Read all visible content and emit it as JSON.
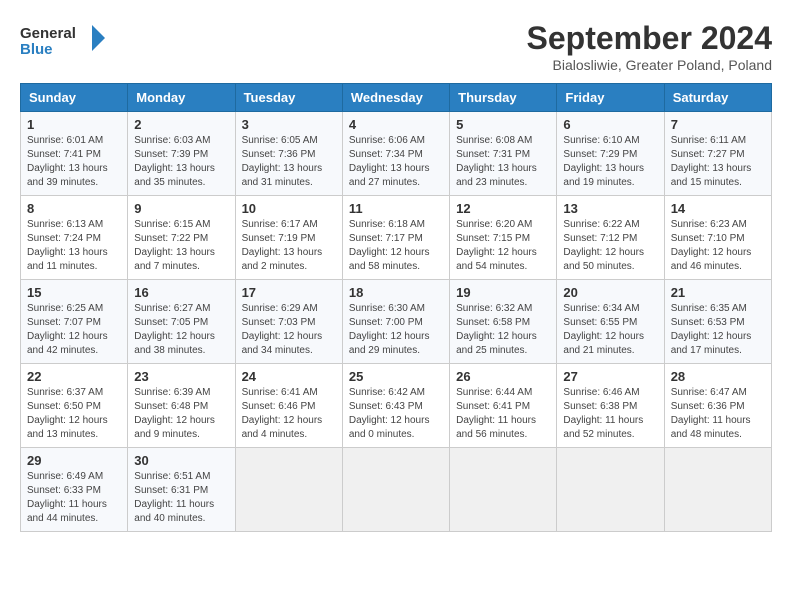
{
  "header": {
    "logo_general": "General",
    "logo_blue": "Blue",
    "title": "September 2024",
    "subtitle": "Bialosliwie, Greater Poland, Poland"
  },
  "calendar": {
    "days_of_week": [
      "Sunday",
      "Monday",
      "Tuesday",
      "Wednesday",
      "Thursday",
      "Friday",
      "Saturday"
    ],
    "weeks": [
      [
        {
          "day": "1",
          "info": "Sunrise: 6:01 AM\nSunset: 7:41 PM\nDaylight: 13 hours\nand 39 minutes."
        },
        {
          "day": "2",
          "info": "Sunrise: 6:03 AM\nSunset: 7:39 PM\nDaylight: 13 hours\nand 35 minutes."
        },
        {
          "day": "3",
          "info": "Sunrise: 6:05 AM\nSunset: 7:36 PM\nDaylight: 13 hours\nand 31 minutes."
        },
        {
          "day": "4",
          "info": "Sunrise: 6:06 AM\nSunset: 7:34 PM\nDaylight: 13 hours\nand 27 minutes."
        },
        {
          "day": "5",
          "info": "Sunrise: 6:08 AM\nSunset: 7:31 PM\nDaylight: 13 hours\nand 23 minutes."
        },
        {
          "day": "6",
          "info": "Sunrise: 6:10 AM\nSunset: 7:29 PM\nDaylight: 13 hours\nand 19 minutes."
        },
        {
          "day": "7",
          "info": "Sunrise: 6:11 AM\nSunset: 7:27 PM\nDaylight: 13 hours\nand 15 minutes."
        }
      ],
      [
        {
          "day": "8",
          "info": "Sunrise: 6:13 AM\nSunset: 7:24 PM\nDaylight: 13 hours\nand 11 minutes."
        },
        {
          "day": "9",
          "info": "Sunrise: 6:15 AM\nSunset: 7:22 PM\nDaylight: 13 hours\nand 7 minutes."
        },
        {
          "day": "10",
          "info": "Sunrise: 6:17 AM\nSunset: 7:19 PM\nDaylight: 13 hours\nand 2 minutes."
        },
        {
          "day": "11",
          "info": "Sunrise: 6:18 AM\nSunset: 7:17 PM\nDaylight: 12 hours\nand 58 minutes."
        },
        {
          "day": "12",
          "info": "Sunrise: 6:20 AM\nSunset: 7:15 PM\nDaylight: 12 hours\nand 54 minutes."
        },
        {
          "day": "13",
          "info": "Sunrise: 6:22 AM\nSunset: 7:12 PM\nDaylight: 12 hours\nand 50 minutes."
        },
        {
          "day": "14",
          "info": "Sunrise: 6:23 AM\nSunset: 7:10 PM\nDaylight: 12 hours\nand 46 minutes."
        }
      ],
      [
        {
          "day": "15",
          "info": "Sunrise: 6:25 AM\nSunset: 7:07 PM\nDaylight: 12 hours\nand 42 minutes."
        },
        {
          "day": "16",
          "info": "Sunrise: 6:27 AM\nSunset: 7:05 PM\nDaylight: 12 hours\nand 38 minutes."
        },
        {
          "day": "17",
          "info": "Sunrise: 6:29 AM\nSunset: 7:03 PM\nDaylight: 12 hours\nand 34 minutes."
        },
        {
          "day": "18",
          "info": "Sunrise: 6:30 AM\nSunset: 7:00 PM\nDaylight: 12 hours\nand 29 minutes."
        },
        {
          "day": "19",
          "info": "Sunrise: 6:32 AM\nSunset: 6:58 PM\nDaylight: 12 hours\nand 25 minutes."
        },
        {
          "day": "20",
          "info": "Sunrise: 6:34 AM\nSunset: 6:55 PM\nDaylight: 12 hours\nand 21 minutes."
        },
        {
          "day": "21",
          "info": "Sunrise: 6:35 AM\nSunset: 6:53 PM\nDaylight: 12 hours\nand 17 minutes."
        }
      ],
      [
        {
          "day": "22",
          "info": "Sunrise: 6:37 AM\nSunset: 6:50 PM\nDaylight: 12 hours\nand 13 minutes."
        },
        {
          "day": "23",
          "info": "Sunrise: 6:39 AM\nSunset: 6:48 PM\nDaylight: 12 hours\nand 9 minutes."
        },
        {
          "day": "24",
          "info": "Sunrise: 6:41 AM\nSunset: 6:46 PM\nDaylight: 12 hours\nand 4 minutes."
        },
        {
          "day": "25",
          "info": "Sunrise: 6:42 AM\nSunset: 6:43 PM\nDaylight: 12 hours\nand 0 minutes."
        },
        {
          "day": "26",
          "info": "Sunrise: 6:44 AM\nSunset: 6:41 PM\nDaylight: 11 hours\nand 56 minutes."
        },
        {
          "day": "27",
          "info": "Sunrise: 6:46 AM\nSunset: 6:38 PM\nDaylight: 11 hours\nand 52 minutes."
        },
        {
          "day": "28",
          "info": "Sunrise: 6:47 AM\nSunset: 6:36 PM\nDaylight: 11 hours\nand 48 minutes."
        }
      ],
      [
        {
          "day": "29",
          "info": "Sunrise: 6:49 AM\nSunset: 6:33 PM\nDaylight: 11 hours\nand 44 minutes."
        },
        {
          "day": "30",
          "info": "Sunrise: 6:51 AM\nSunset: 6:31 PM\nDaylight: 11 hours\nand 40 minutes."
        },
        {
          "day": "",
          "info": ""
        },
        {
          "day": "",
          "info": ""
        },
        {
          "day": "",
          "info": ""
        },
        {
          "day": "",
          "info": ""
        },
        {
          "day": "",
          "info": ""
        }
      ]
    ]
  }
}
